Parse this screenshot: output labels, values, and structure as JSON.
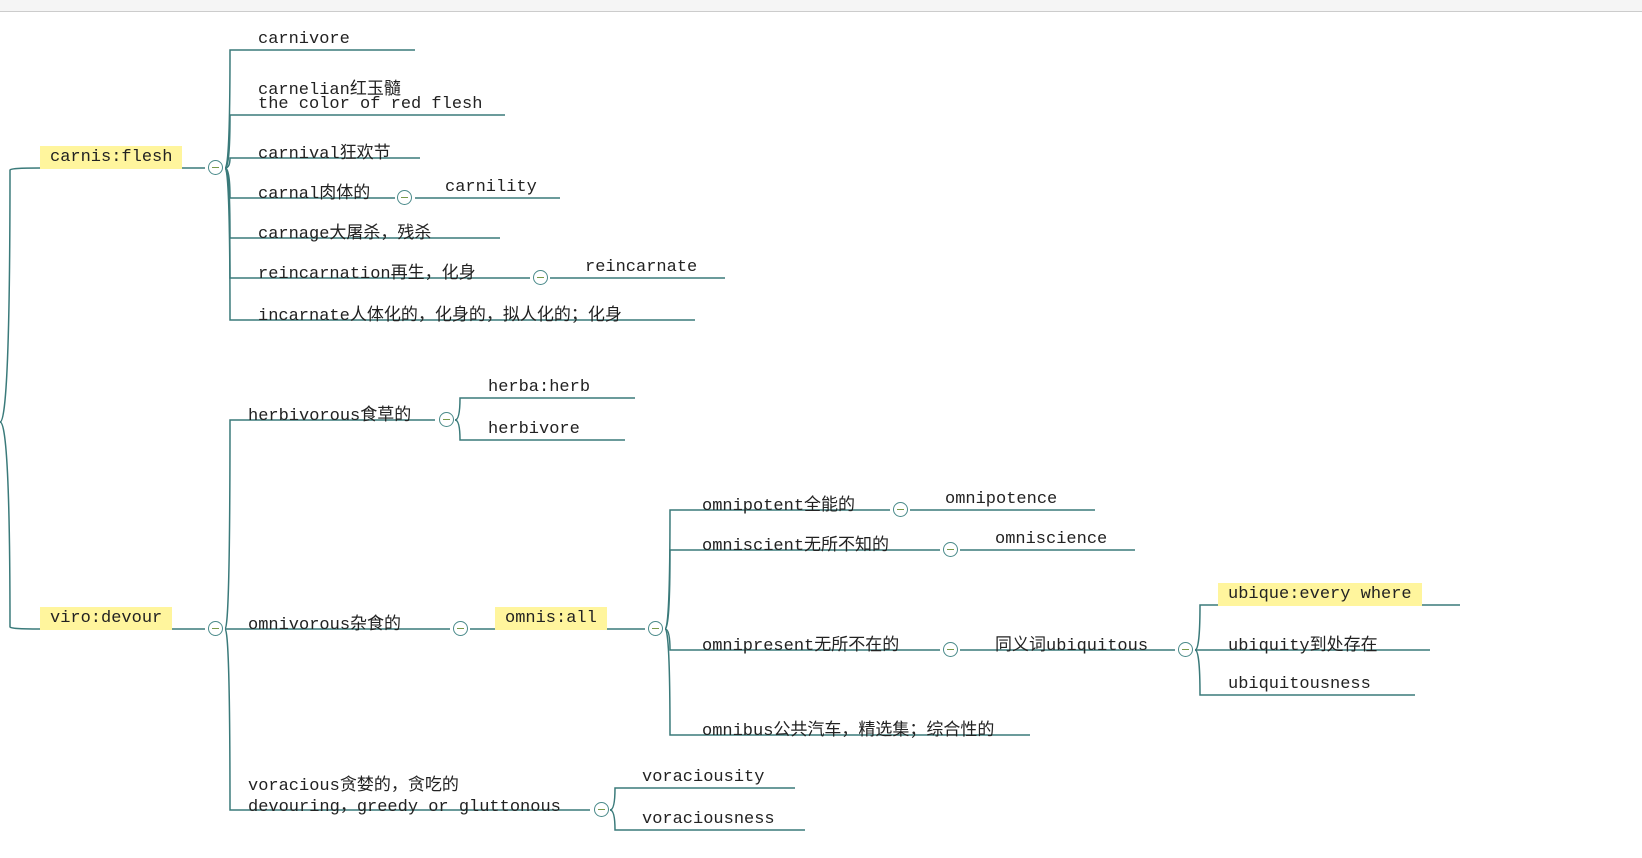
{
  "nodes": {
    "carnis": "carnis:flesh",
    "carnivore": "carnivore",
    "carnelian_l1": "carnelian红玉髓",
    "carnelian_l2": "the color of red flesh",
    "carnival": "carnival狂欢节",
    "carnal": "carnal肉体的",
    "carnility": "carnility",
    "carnage": "carnage大屠杀，残杀",
    "reincarnation": "reincarnation再生，化身",
    "reincarnate": "reincarnate",
    "incarnate": "incarnate人体化的，化身的，拟人化的；化身",
    "viro": "viro:devour",
    "herbivorous": "herbivorous食草的",
    "herba": "herba:herb",
    "herbivore": "herbivore",
    "omnivorous": "omnivorous杂食的",
    "omnis": "omnis:all",
    "omnipotent": "omnipotent全能的",
    "omnipotence": "omnipotence",
    "omniscient": "omniscient无所不知的",
    "omniscience": "omniscience",
    "omnipresent": "omnipresent无所不在的",
    "syn_ubiquitous": "同义词ubiquitous",
    "ubique": "ubique:every where",
    "ubiquity": "ubiquity到处存在",
    "ubiquitousness": "ubiquitousness",
    "omnibus": "omnibus公共汽车，精选集；综合性的",
    "voracious_l1": "voracious贪婪的，贪吃的",
    "voracious_l2": "devouring，greedy or gluttonous",
    "voraciousity": "voraciousity",
    "voraciousness": "voraciousness"
  }
}
